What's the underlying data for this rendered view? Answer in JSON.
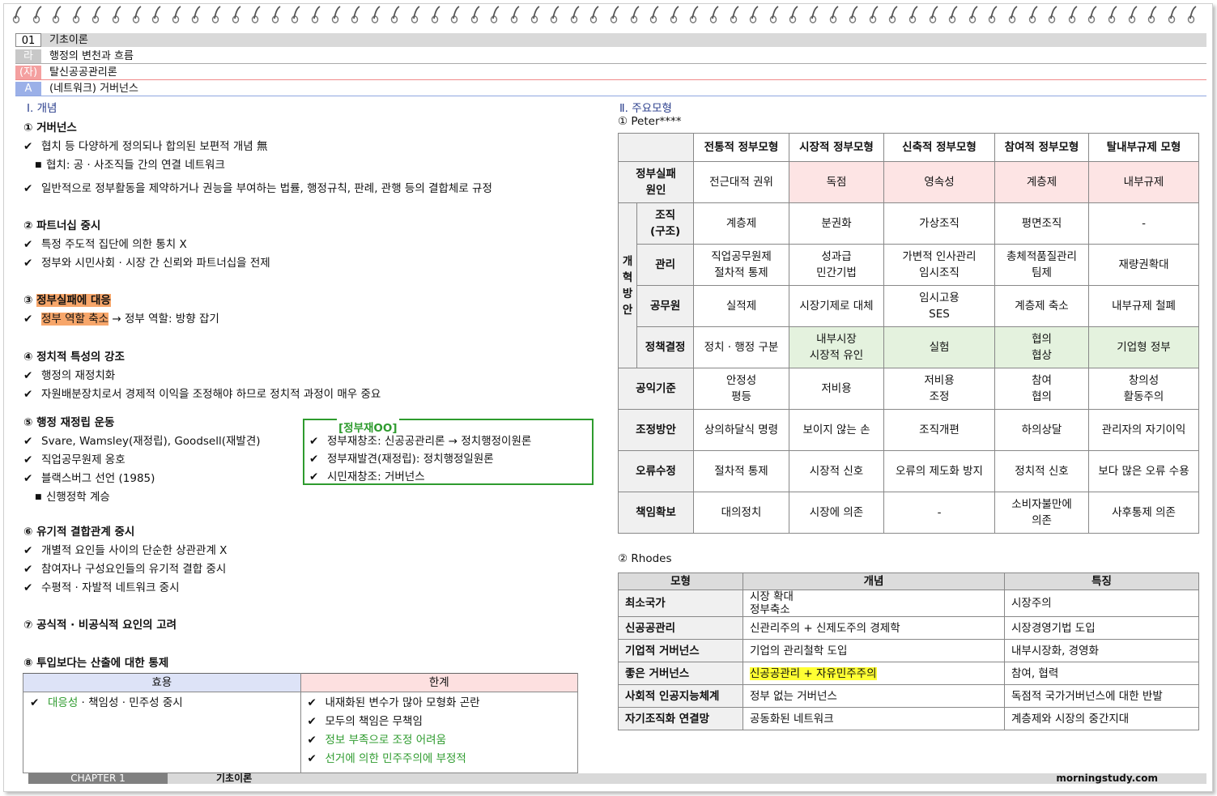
{
  "breadcrumbs": [
    {
      "tag": "01",
      "text": "기초이론"
    },
    {
      "tag": "라",
      "text": "행정의 변천과 흐름"
    },
    {
      "tag": "(자)",
      "text": "탈신공공관리론"
    },
    {
      "tag": "A",
      "text": "(네트워크) 거버넌스"
    }
  ],
  "left": {
    "section_title": "Ⅰ. 개념",
    "h1": "① 거버넌스",
    "l1a": "협치 등 다양하게 정의되나 합의된 보편적 개념 無",
    "l1b": "협치: 공 · 사조직들 간의 연결 네트워크",
    "l1c": "일반적으로 정부활동을 제약하거나 권능을 부여하는 법률, 행정규칙, 판례, 관행 등의 결합체로 규정",
    "h2": "② 파트너십 중시",
    "l2a": "특정 주도적 집단에 의한 통치 X",
    "l2b": "정부와 시민사회 · 시장 간 신뢰와 파트너십을 전제",
    "h3_prefix": "③",
    "h3_hl": "정부실패에 대응",
    "l3_hl": "정부 역할 축소",
    "l3_rest": " → 정부 역할: 방향 잡기",
    "h4": "④ 정치적 특성의 강조",
    "l4a": "행정의 재정치화",
    "l4b": "자원배분장치로서 경제적 이익을 조정해야 하므로 정치적 과정이 매우 중요",
    "h5": "⑤ 행정 재정립 운동",
    "l5a": "Svare, Wamsley(재정립), Goodsell(재발견)",
    "l5b": "직업공무원제 옹호",
    "l5c": "블랙스버그 선언 (1985)",
    "l5d": "신행정학 계승",
    "box_title": "[정부재OO]",
    "box1": "정부재창조: 신공공관리론 → 정치행정이원론",
    "box2": "정부재발견(재정립): 정치행정일원론",
    "box3": "시민재창조: 거버넌스",
    "h6": "⑥ 유기적 결합관계 중시",
    "l6a": "개별적 요인들 사이의 단순한 상관관계 X",
    "l6b": "참여자나 구성요인들의 유기적 결합 중시",
    "l6c": "수평적 · 자발적 네트워크 중시",
    "h7": "⑦ 공식적 · 비공식적 요인의 고려",
    "h8": "⑧ 투입보다는 산출에 대한 통제",
    "eff_head": "효용",
    "lim_head": "한계",
    "eff_green": "대응성",
    "eff_rest": " · 책임성 · 민주성 중시",
    "lim1": "내재화된 변수가 많아 모형화 곤란",
    "lim2": "모두의 책임은 무책임",
    "lim3": "정보 부족으로 조정 어려움",
    "lim4": "선거에 의한 민주주의에 부정적"
  },
  "right": {
    "section_title": "Ⅱ. 주요모형",
    "peter_title": "① Peter****",
    "peter_headers": [
      "전통적 정부모형",
      "시장적 정부모형",
      "신축적 정부모형",
      "참여적 정부모형",
      "탈내부규제 모형"
    ],
    "row_gf": "정부실패\n원인",
    "gf": [
      "전근대적 권위",
      "독점",
      "영속성",
      "계층제",
      "내부규제"
    ],
    "reform": "개\n혁\n방\n안",
    "row_org": "조직\n(구조)",
    "org": [
      "계층제",
      "분권화",
      "가상조직",
      "평면조직",
      "-"
    ],
    "row_mgmt": "관리",
    "mgmt": [
      "직업공무원제\n절차적 통제",
      "성과급\n민간기법",
      "가변적 인사관리\n임시조직",
      "총체적품질관리\n팀제",
      "재량권확대"
    ],
    "row_civ": "공무원",
    "civ": [
      "실적제",
      "시장기제로 대체",
      "임시고용\nSES",
      "계층제 축소",
      "내부규제 철폐"
    ],
    "row_pol": "정책결정",
    "pol": [
      "정치 · 행정 구분",
      "내부시장\n시장적 유인",
      "실험",
      "협의\n협상",
      "기업형 정부"
    ],
    "row_pub": "공익기준",
    "pub": [
      "안정성\n평등",
      "저비용",
      "저비용\n조정",
      "참여\n협의",
      "창의성\n활동주의"
    ],
    "row_coord": "조정방안",
    "coord": [
      "상의하달식 명령",
      "보이지 않는 손",
      "조직개편",
      "하의상달",
      "관리자의 자기이익"
    ],
    "row_err": "오류수정",
    "err": [
      "절차적 통제",
      "시장적 신호",
      "오류의 제도화 방지",
      "정치적 신호",
      "보다 많은 오류 수용"
    ],
    "row_acc": "책임확보",
    "acc": [
      "대의정치",
      "시장에 의존",
      "-",
      "소비자불만에\n의존",
      "사후통제 의존"
    ],
    "rhodes_title": "② Rhodes",
    "rhodes_headers": [
      "모형",
      "개념",
      "특징"
    ],
    "rhodes_rows": [
      [
        "최소국가",
        "시장 확대\n정부축소",
        "시장주의"
      ],
      [
        "신공공관리",
        "신관리주의 + 신제도주의 경제학",
        "시장경영기법 도입"
      ],
      [
        "기업적 거버넌스",
        "기업의 관리철학 도입",
        "내부시장화, 경영화"
      ],
      [
        "좋은 거버넌스",
        "신공공관리 + 자유민주주의",
        "참여, 협력"
      ],
      [
        "사회적 인공지능체계",
        "정부 없는 거버넌스",
        "독점적 국가거버넌스에 대한 반발"
      ],
      [
        "자기조직화 연결망",
        "공동화된 네트워크",
        "계층제와 시장의 중간지대"
      ]
    ]
  },
  "footer": {
    "chapter": "CHAPTER 1",
    "title": "기초이론",
    "site": "morningstudy.com"
  },
  "colors": {
    "pink": "#fde4e4",
    "light_green": "#e4f2de",
    "orange_highlight": "#f7a66a",
    "yellow_highlight": "#ffff33",
    "green": "#2e9b2e",
    "section_blue": "#2a3e8c"
  }
}
